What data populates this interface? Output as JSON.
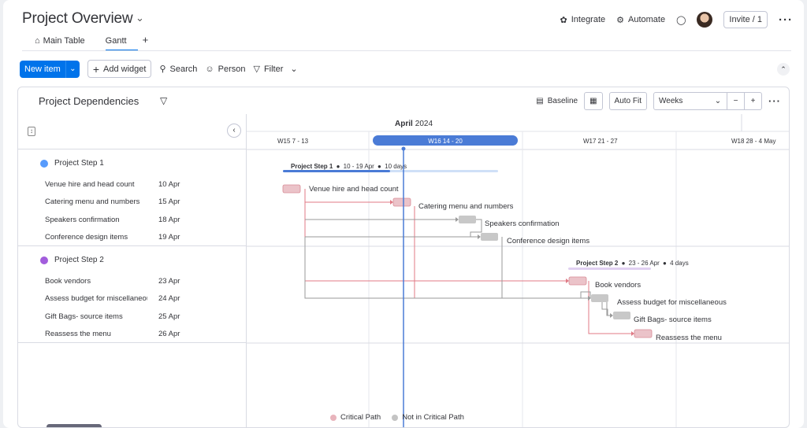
{
  "header": {
    "title": "Project Overview",
    "tabs": [
      {
        "label": "Main Table"
      },
      {
        "label": "Gantt"
      }
    ],
    "integrate_label": "Integrate",
    "automate_label": "Automate",
    "invite_label": "Invite / 1"
  },
  "toolbar": {
    "new_item_label": "New item",
    "add_widget_label": "Add widget",
    "search_label": "Search",
    "person_label": "Person",
    "filter_label": "Filter"
  },
  "panel": {
    "title": "Project Dependencies",
    "baseline_label": "Baseline",
    "autofit_label": "Auto Fit",
    "weeks_label": "Weeks"
  },
  "timeline": {
    "month": "April",
    "year": "2024",
    "weeks": [
      "W15 7 - 13",
      "W16 14 - 20",
      "W17 21 - 27",
      "W18 28 - 4 May"
    ],
    "current_week_index": 1
  },
  "groups": [
    {
      "name": "Project Step 1",
      "color": "#579bfc",
      "summary_range": "10 - 19 Apr",
      "summary_duration": "10 days",
      "tasks": [
        {
          "name": "Venue hire and head count",
          "date": "10 Apr",
          "critical": true
        },
        {
          "name": "Catering menu and numbers",
          "date": "15 Apr",
          "critical": true
        },
        {
          "name": "Speakers confirmation",
          "date": "18 Apr",
          "critical": false
        },
        {
          "name": "Conference design items",
          "date": "19 Apr",
          "critical": false
        }
      ]
    },
    {
      "name": "Project Step 2",
      "color": "#a25ddc",
      "summary_range": "23 - 26 Apr",
      "summary_duration": "4 days",
      "tasks": [
        {
          "name": "Book vendors",
          "date": "23 Apr",
          "critical": true
        },
        {
          "name": "Assess budget for miscellaneous",
          "date": "24 Apr",
          "critical": false
        },
        {
          "name": "Gift Bags- source items",
          "date": "25 Apr",
          "critical": false
        },
        {
          "name": "Reassess the menu",
          "date": "26 Apr",
          "critical": true
        }
      ]
    }
  ],
  "legend": {
    "critical_label": "Critical Path",
    "critical_color": "#e8b4bc",
    "noncritical_label": "Not in Critical Path",
    "noncritical_color": "#c4c4c4"
  },
  "colors": {
    "accent": "#0073ea",
    "today_line": "#4a7bd6",
    "critical_link": "#e07a85",
    "noncritical_link": "#9a9a9a"
  }
}
